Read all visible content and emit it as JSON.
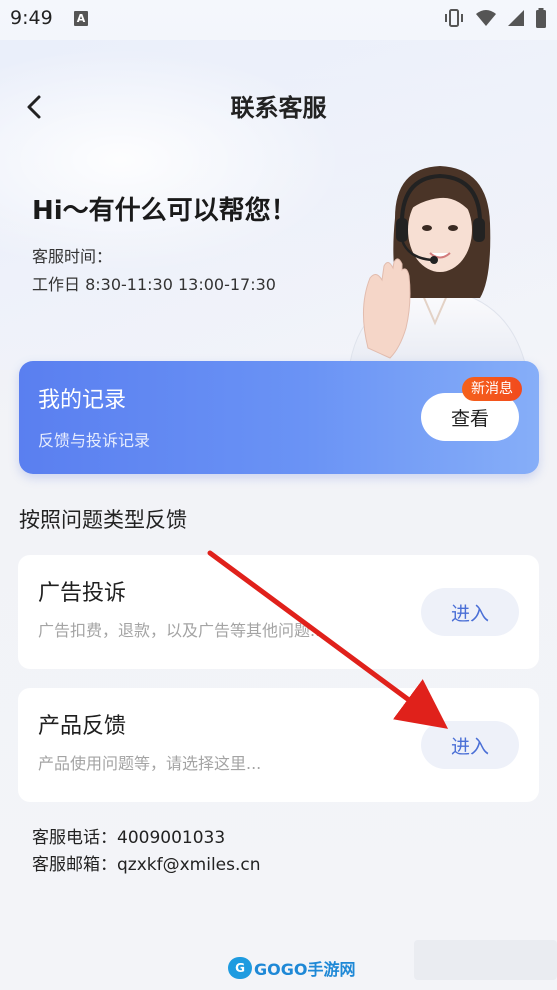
{
  "status_bar": {
    "time": "9:49",
    "a_icon": "A"
  },
  "header": {
    "title": "联系客服"
  },
  "hero": {
    "greeting": "Hi～有什么可以帮您！",
    "hours_label": "客服时间：",
    "hours_value": "工作日 8:30-11:30 13:00-17:30"
  },
  "records": {
    "title": "我的记录",
    "subtitle": "反馈与投诉记录",
    "view_label": "查看",
    "badge": "新消息"
  },
  "section_title": "按照问题类型反馈",
  "feedback_types": [
    {
      "title": "广告投诉",
      "desc": "广告扣费，退款，以及广告等其他问题...",
      "button": "进入"
    },
    {
      "title": "产品反馈",
      "desc": "产品使用问题等，请选择这里...",
      "button": "进入"
    }
  ],
  "contact": {
    "phone": "客服电话：4009001033",
    "email": "客服邮箱：qzxkf@xmiles.cn"
  },
  "watermark": {
    "logo": "G",
    "text": "GOGO手游网"
  },
  "colors": {
    "accent": "#4a6fd6",
    "card_gradient_start": "#5a7ff0",
    "badge": "#f24a1c",
    "arrow": "#e0211b"
  }
}
